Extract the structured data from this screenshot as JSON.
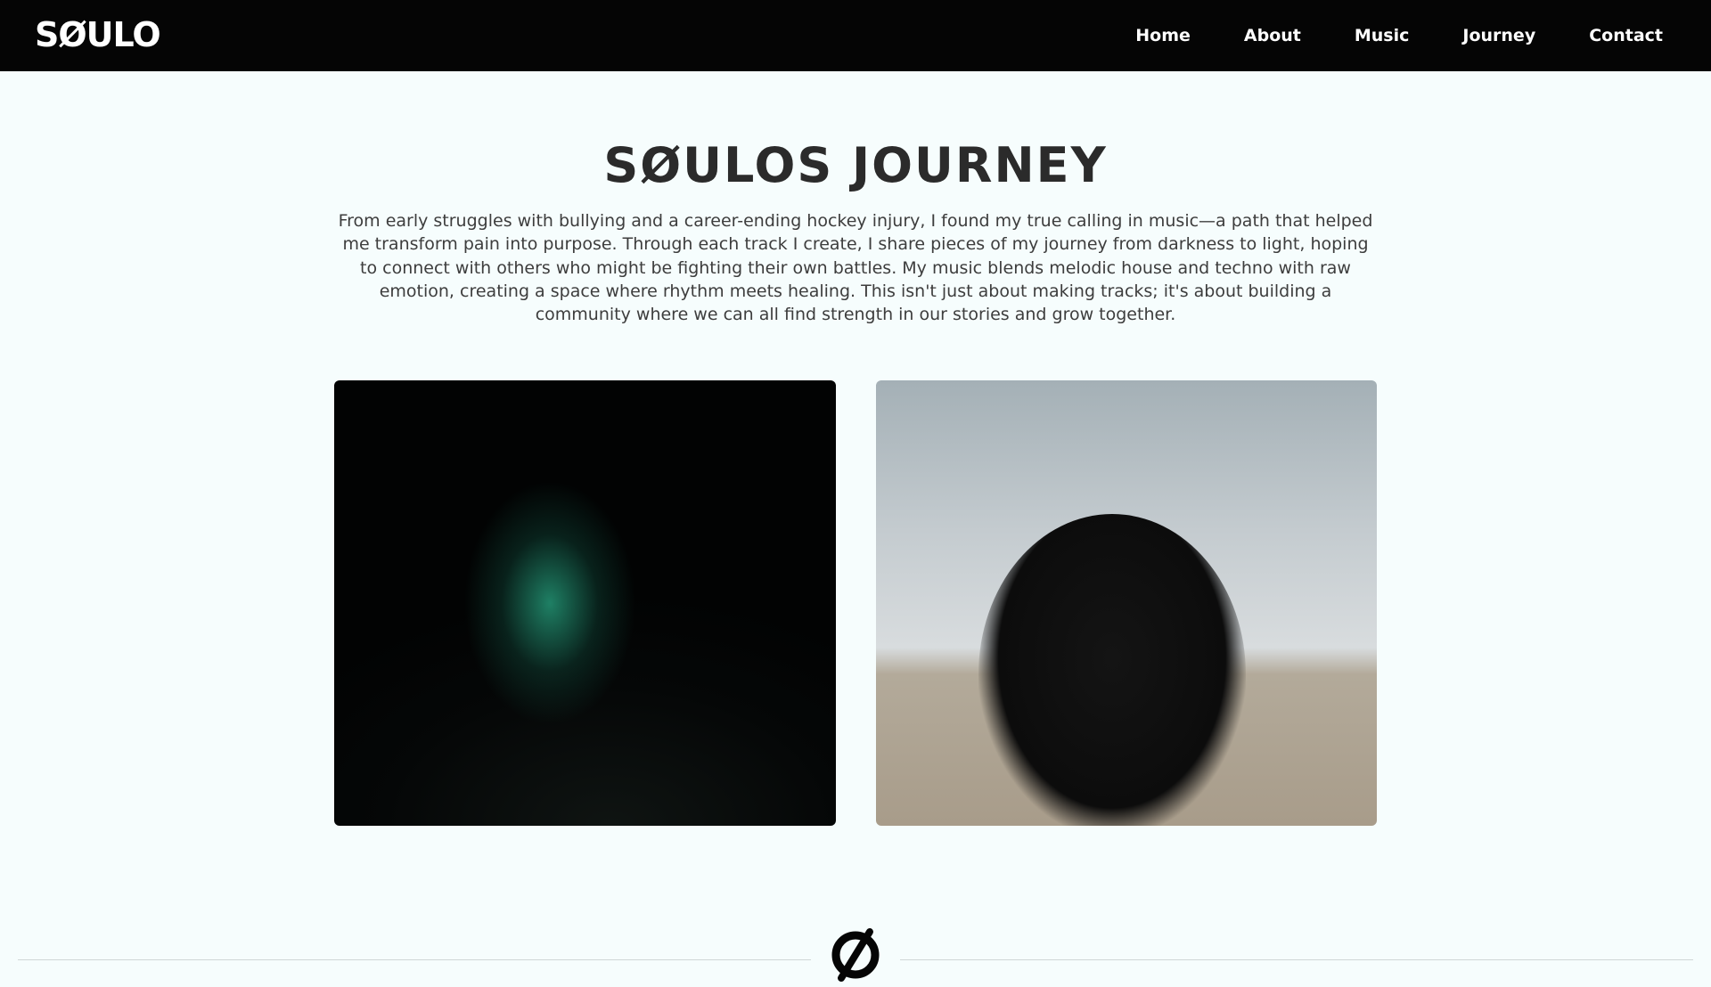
{
  "header": {
    "logo_text": "SØULO",
    "nav": [
      {
        "label": "Home"
      },
      {
        "label": "About"
      },
      {
        "label": "Music"
      },
      {
        "label": "Journey"
      },
      {
        "label": "Contact"
      }
    ]
  },
  "main": {
    "title": "SØULOS JOURNEY",
    "intro": "From early struggles with bullying and a career-ending hockey injury, I found my true calling in music—a path that helped me transform pain into purpose. Through each track I create, I share pieces of my journey from darkness to light, hoping to connect with others who might be fighting their own battles. My music blends melodic house and techno with raw emotion, creating a space where rhythm meets healing. This isn't just about making tracks; it's about building a community where we can all find strength in our stories and grow together."
  },
  "colors": {
    "header_bg": "#050505",
    "page_bg": "#f6fdfd",
    "title": "#2b2b2b",
    "body_text": "#3d3d3d",
    "accent_glow": "#36e6b4"
  },
  "icons": {
    "divider": "soulo-emblem-icon"
  }
}
